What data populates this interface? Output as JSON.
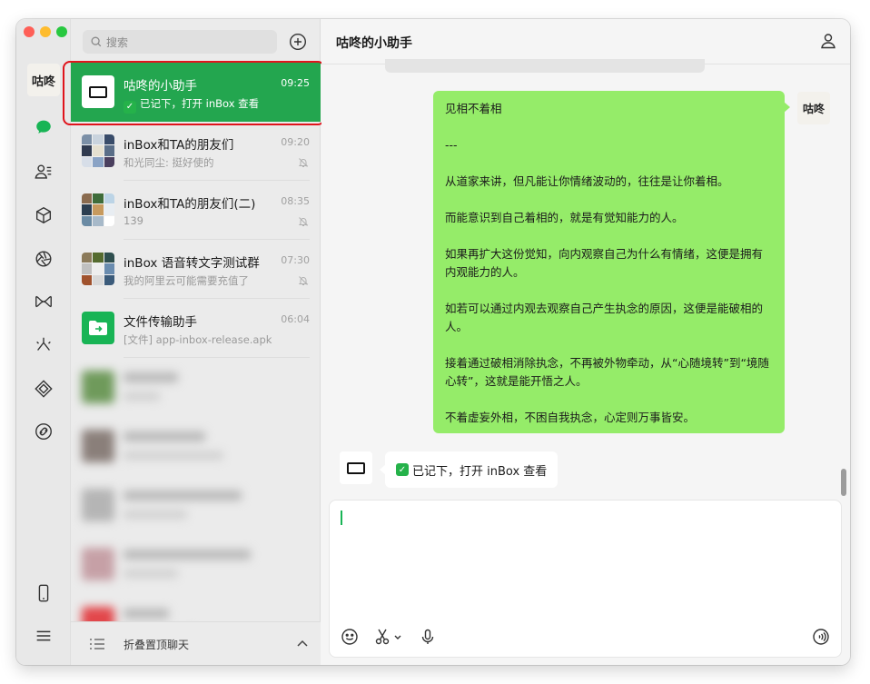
{
  "sidebar": {
    "avatar_text": "咕咚"
  },
  "search": {
    "placeholder": "搜索"
  },
  "chats": [
    {
      "name": "咕咚的小助手",
      "preview": "已记下，打开 inBox 查看",
      "time": "09:25",
      "active": true,
      "muted": false
    },
    {
      "name": "inBox和TA的朋友们",
      "preview": "和光同尘: 挺好使的",
      "time": "09:20",
      "active": false,
      "muted": true
    },
    {
      "name": "inBox和TA的朋友们(二)",
      "preview": "139",
      "time": "08:35",
      "active": false,
      "muted": true
    },
    {
      "name": "inBox 语音转文字测试群",
      "preview": "我的阿里云可能需要充值了",
      "time": "07:30",
      "active": false,
      "muted": true
    },
    {
      "name": "文件传输助手",
      "preview": "[文件] app-inbox-release.apk",
      "time": "06:04",
      "active": false,
      "muted": false
    }
  ],
  "folded": {
    "label": "折叠置顶聊天"
  },
  "conversation": {
    "title": "咕咚的小助手",
    "sent_message": [
      "见相不着相",
      "---",
      "从道家来讲，但凡能让你情绪波动的，往往是让你着相。",
      "而能意识到自己着相的，就是有觉知能力的人。",
      "如果再扩大这份觉知，向内观察自己为什么有情绪，这便是拥有内观能力的人。",
      "如若可以通过内观去观察自己产生执念的原因，这便是能破相的人。",
      "接着通过破相消除执念，不再被外物牵动，从“心随境转”到“境随心转”，这就是能开悟之人。",
      "不着虚妄外相，不困自我执念，心定则万事皆安。"
    ],
    "reply": "已记下，打开 inBox 查看",
    "avatar_text": "咕咚"
  },
  "colors": {
    "accent": "#23a64f",
    "sent_bubble": "#95ec69",
    "highlight_border": "#e0141c"
  }
}
